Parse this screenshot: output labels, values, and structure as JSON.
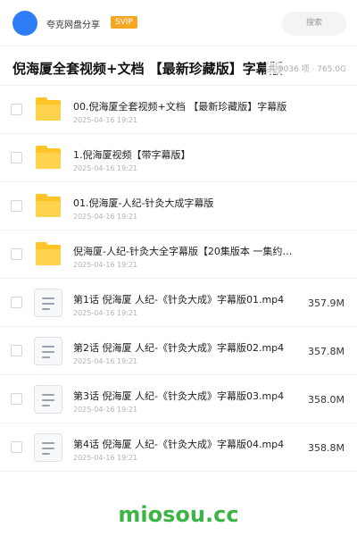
{
  "header": {
    "brand": "夸克网盘分享",
    "badge": "SVIP",
    "search_label": "搜索",
    "accent_color": "#2f7df6"
  },
  "page": {
    "title": "倪海厦全套视频+文档 【最新珍藏版】字幕版",
    "summary": "共 9036 项 · 765.0G"
  },
  "files": [
    {
      "type": "folder",
      "icon": "folder-icon",
      "name": "00.倪海厦全套视频+文档 【最新珍藏版】字幕版",
      "date": "2025-04-16 19:21",
      "size": ""
    },
    {
      "type": "folder",
      "icon": "folder-icon",
      "name": "1.倪海厦视频【带字幕版】",
      "date": "2025-04-16 19:21",
      "size": ""
    },
    {
      "type": "folder",
      "icon": "folder-icon",
      "name": "01.倪海厦-人纪-针灸大成字幕版",
      "date": "2025-04-16 19:21",
      "size": ""
    },
    {
      "type": "folder",
      "icon": "folder-icon",
      "name": "倪海厦-人纪-针灸大全字幕版【20集版本 一集约…",
      "date": "2025-04-16 19:21",
      "size": ""
    },
    {
      "type": "file",
      "icon": "document-icon",
      "name": "第1话 倪海厦 人纪-《针灸大成》字幕版01.mp4",
      "date": "2025-04-16 19:21",
      "size": "357.9M"
    },
    {
      "type": "file",
      "icon": "document-icon",
      "name": "第2话 倪海厦 人纪-《针灸大成》字幕版02.mp4",
      "date": "2025-04-16 19:21",
      "size": "357.8M"
    },
    {
      "type": "file",
      "icon": "document-icon",
      "name": "第3话 倪海厦 人纪-《针灸大成》字幕版03.mp4",
      "date": "2025-04-16 19:21",
      "size": "358.0M"
    },
    {
      "type": "file",
      "icon": "document-icon",
      "name": "第4话 倪海厦 人纪-《针灸大成》字幕版04.mp4",
      "date": "2025-04-16 19:21",
      "size": "358.8M"
    }
  ],
  "watermark": "miosou.cc"
}
